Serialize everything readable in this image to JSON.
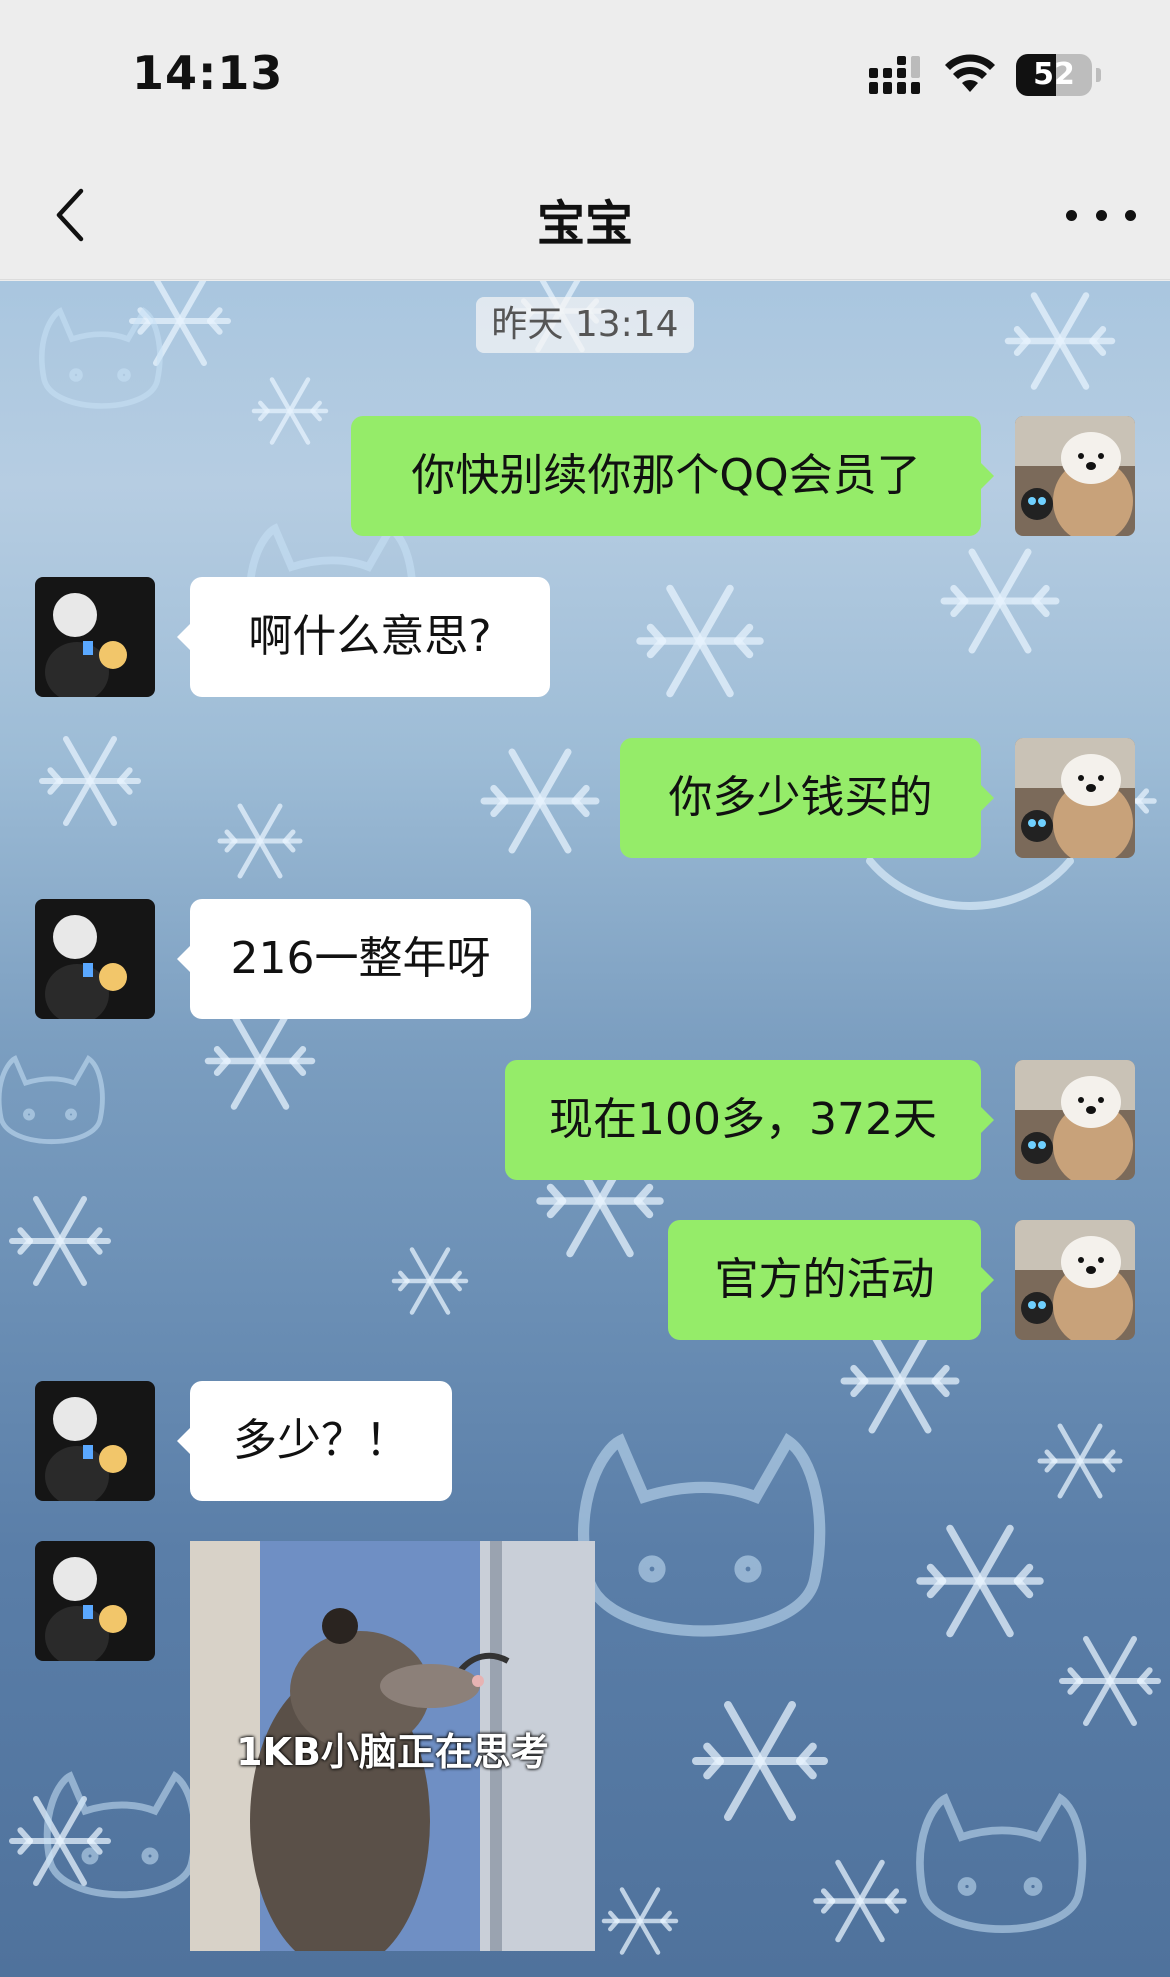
{
  "status_bar": {
    "time": "14:13",
    "battery": "52",
    "battery_level": 0.52
  },
  "header": {
    "title": "宝宝",
    "back_icon": "chevron-left-icon",
    "more_icon": "more-dots-icon"
  },
  "chat": {
    "timestamp": "昨天 13:14",
    "messages": [
      {
        "from": "me",
        "text": "你快别续你那个QQ会员了"
      },
      {
        "from": "contact",
        "text": "啊什么意思?"
      },
      {
        "from": "me",
        "text": "你多少钱买的"
      },
      {
        "from": "contact",
        "text": "216一整年呀"
      },
      {
        "from": "me",
        "text": "现在100多，372天"
      },
      {
        "from": "me",
        "text": "官方的活动"
      },
      {
        "from": "contact",
        "text": "多少？！"
      },
      {
        "from": "contact",
        "sticker_caption": "1KB小脑正在思考"
      }
    ]
  },
  "colors": {
    "outgoing_bubble": "#95ec69",
    "incoming_bubble": "#ffffff",
    "header_bg": "#ededed"
  }
}
